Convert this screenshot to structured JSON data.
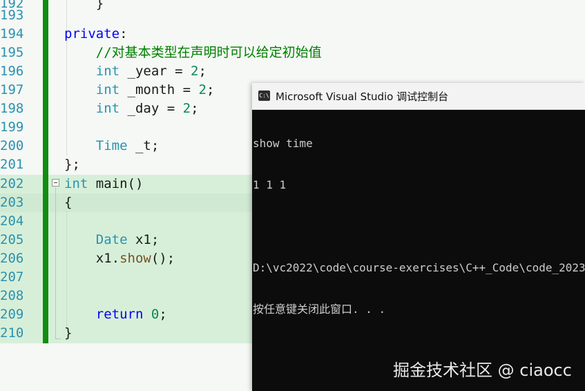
{
  "editor": {
    "lines": [
      {
        "n": "192",
        "code": "    }"
      },
      {
        "n": "193",
        "code": ""
      },
      {
        "n": "194",
        "code": "private:"
      },
      {
        "n": "195",
        "code": "    //对基本类型在声明时可以给定初始值"
      },
      {
        "n": "196",
        "code": "    int _year = 2;"
      },
      {
        "n": "197",
        "code": "    int _month = 2;"
      },
      {
        "n": "198",
        "code": "    int _day = 2;"
      },
      {
        "n": "199",
        "code": ""
      },
      {
        "n": "200",
        "code": "    Time _t;"
      },
      {
        "n": "201",
        "code": "};"
      },
      {
        "n": "202",
        "code": "int main()"
      },
      {
        "n": "203",
        "code": "{"
      },
      {
        "n": "204",
        "code": ""
      },
      {
        "n": "205",
        "code": "    Date x1;"
      },
      {
        "n": "206",
        "code": "    x1.show();"
      },
      {
        "n": "207",
        "code": ""
      },
      {
        "n": "208",
        "code": ""
      },
      {
        "n": "209",
        "code": "    return 0;"
      },
      {
        "n": "210",
        "code": "}"
      }
    ]
  },
  "console": {
    "title": "Microsoft Visual Studio 调试控制台",
    "icon": "C:\\",
    "output": [
      "show time",
      "1 1 1",
      "",
      "D:\\vc2022\\code\\course-exercises\\C++_Code\\code_2023",
      "按任意键关闭此窗口. . ."
    ]
  },
  "watermark": "掘金技术社区 @ ciaocc",
  "colors": {
    "modified_bar": "#108d10",
    "line_highlight": "#d7efd9",
    "keyword": "#0000ff",
    "type": "#2b91af",
    "comment": "#008000",
    "console_bg": "#0c0c0c"
  }
}
